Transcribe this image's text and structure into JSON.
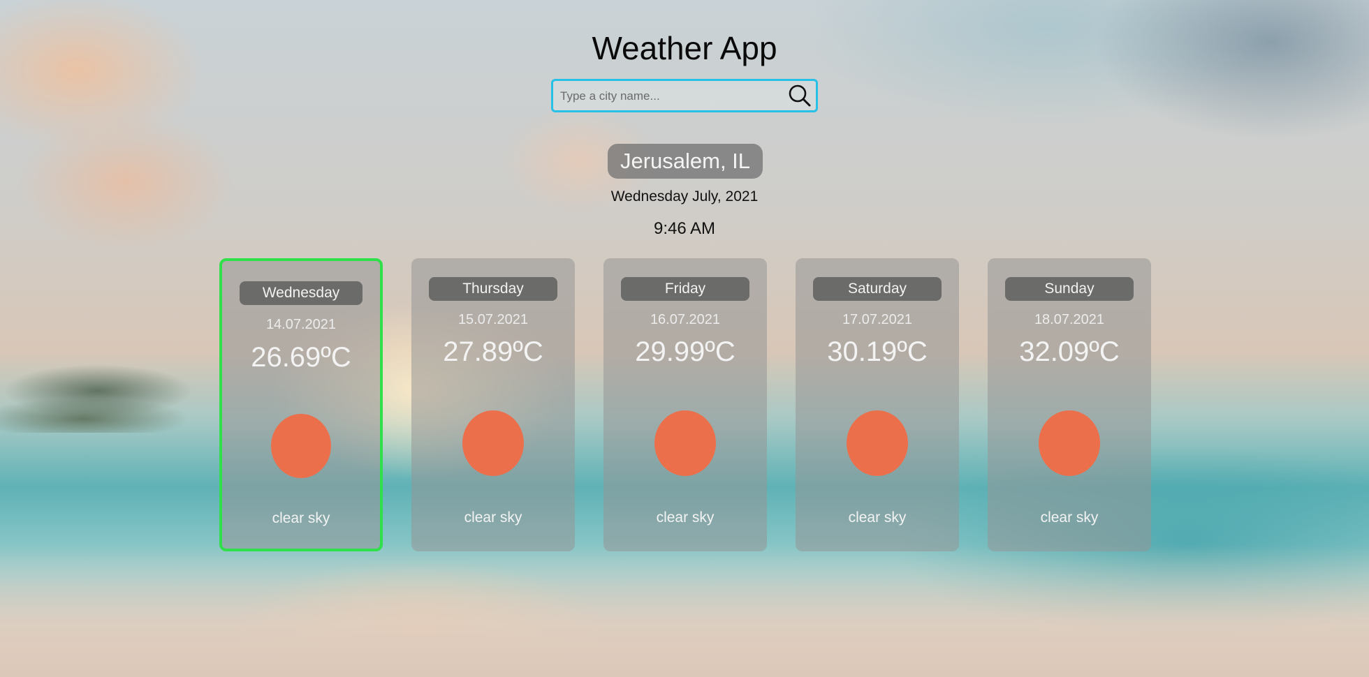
{
  "app": {
    "title": "Weather App"
  },
  "search": {
    "placeholder": "Type a city name...",
    "value": "",
    "icon": "search-icon"
  },
  "location": {
    "city": "Jerusalem, IL",
    "date_line": "Wednesday July, 2021",
    "time": "9:46 AM"
  },
  "colors": {
    "search_border": "#27c0e6",
    "selected_border": "#2fe04a",
    "sun": "#ec6f4c"
  },
  "forecast": [
    {
      "day": "Wednesday",
      "date": "14.07.2021",
      "temp": "26.69ºC",
      "desc": "clear sky",
      "icon": "sun-icon",
      "selected": true
    },
    {
      "day": "Thursday",
      "date": "15.07.2021",
      "temp": "27.89ºC",
      "desc": "clear sky",
      "icon": "sun-icon",
      "selected": false
    },
    {
      "day": "Friday",
      "date": "16.07.2021",
      "temp": "29.99ºC",
      "desc": "clear sky",
      "icon": "sun-icon",
      "selected": false
    },
    {
      "day": "Saturday",
      "date": "17.07.2021",
      "temp": "30.19ºC",
      "desc": "clear sky",
      "icon": "sun-icon",
      "selected": false
    },
    {
      "day": "Sunday",
      "date": "18.07.2021",
      "temp": "32.09ºC",
      "desc": "clear sky",
      "icon": "sun-icon",
      "selected": false
    }
  ]
}
